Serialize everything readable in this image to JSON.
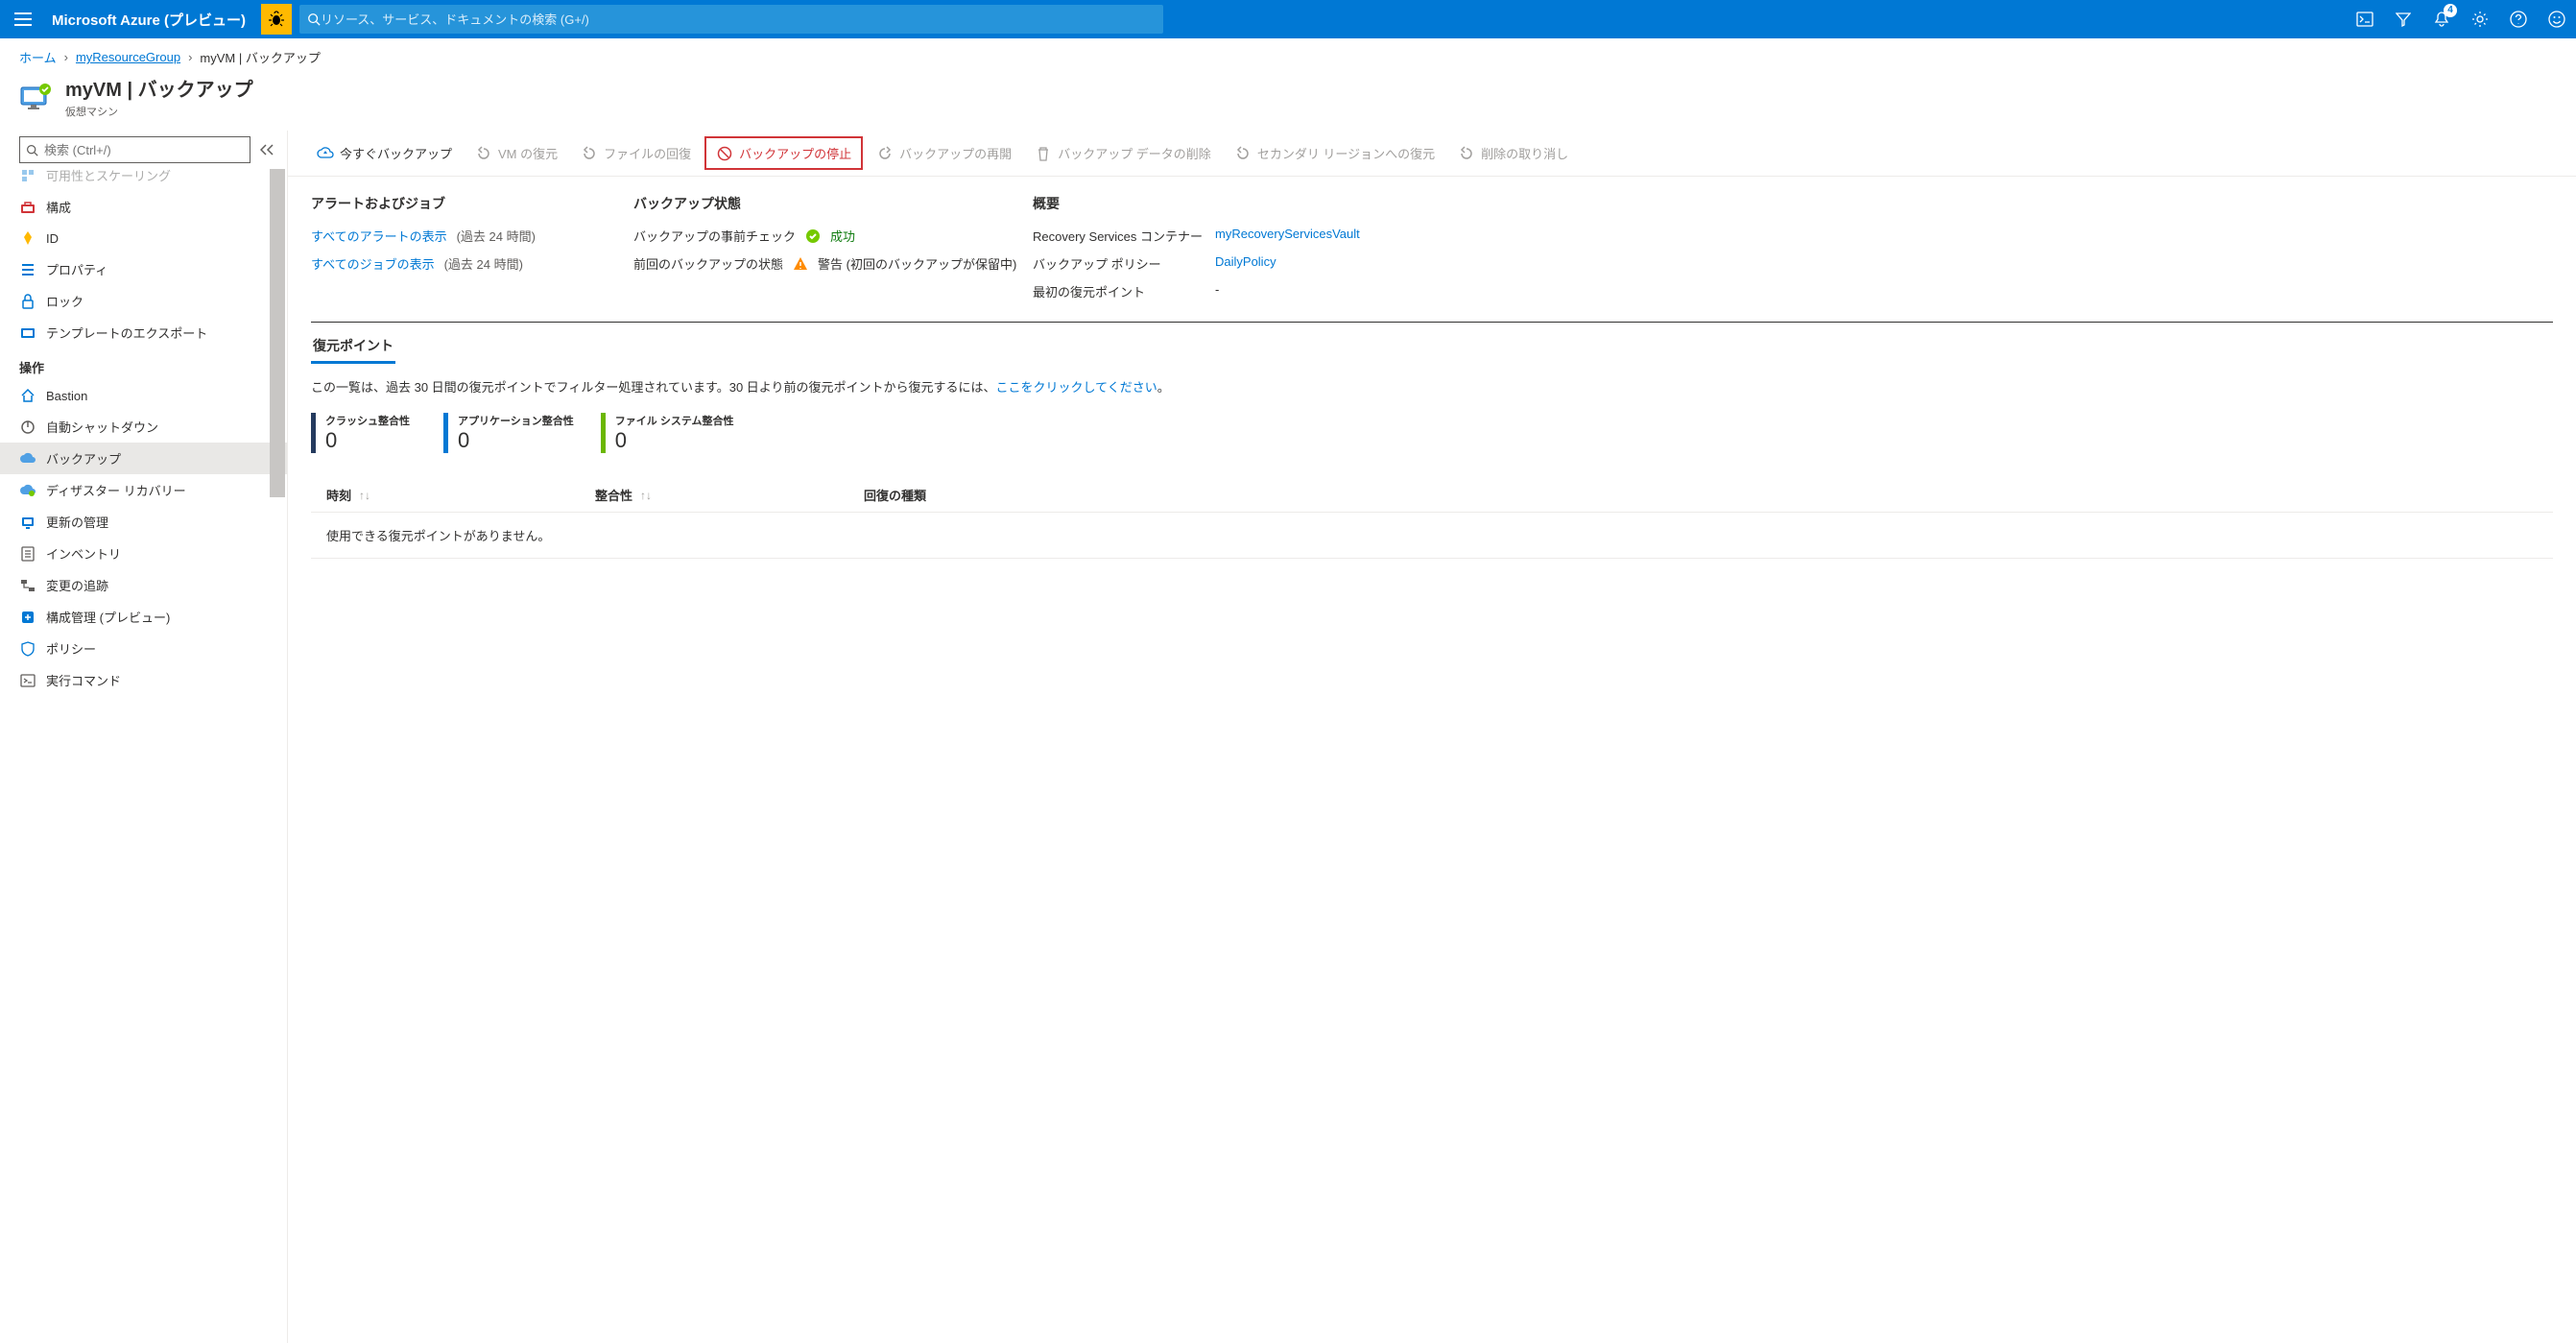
{
  "topbar": {
    "brand": "Microsoft Azure (プレビュー)",
    "search_placeholder": "リソース、サービス、ドキュメントの検索 (G+/)",
    "notification_count": "4"
  },
  "breadcrumb": {
    "home": "ホーム",
    "rg": "myResourceGroup",
    "current": "myVM | バックアップ"
  },
  "resource": {
    "title": "myVM | バックアップ",
    "subtitle": "仮想マシン"
  },
  "sidebar": {
    "search_placeholder": "検索 (Ctrl+/)",
    "items_top": [
      {
        "label": "可用性とスケーリング",
        "icon": "scale"
      },
      {
        "label": "構成",
        "icon": "config"
      },
      {
        "label": "ID",
        "icon": "id"
      },
      {
        "label": "プロパティ",
        "icon": "props"
      },
      {
        "label": "ロック",
        "icon": "lock"
      },
      {
        "label": "テンプレートのエクスポート",
        "icon": "export"
      }
    ],
    "group_ops": "操作",
    "items_ops": [
      {
        "label": "Bastion",
        "icon": "bastion"
      },
      {
        "label": "自動シャットダウン",
        "icon": "autoshut"
      },
      {
        "label": "バックアップ",
        "icon": "backup",
        "active": true
      },
      {
        "label": "ディザスター リカバリー",
        "icon": "dr"
      },
      {
        "label": "更新の管理",
        "icon": "update"
      },
      {
        "label": "インベントリ",
        "icon": "inventory"
      },
      {
        "label": "変更の追跡",
        "icon": "change"
      },
      {
        "label": "構成管理 (プレビュー)",
        "icon": "configmgmt"
      },
      {
        "label": "ポリシー",
        "icon": "policy"
      },
      {
        "label": "実行コマンド",
        "icon": "runcmd"
      }
    ]
  },
  "toolbar": {
    "backup_now": "今すぐバックアップ",
    "restore_vm": "VM の復元",
    "file_recovery": "ファイルの回復",
    "stop_backup": "バックアップの停止",
    "resume_backup": "バックアップの再開",
    "delete_data": "バックアップ データの削除",
    "secondary_restore": "セカンダリ リージョンへの復元",
    "undo_delete": "削除の取り消し"
  },
  "alerts": {
    "heading": "アラートおよびジョブ",
    "view_alerts": "すべてのアラートの表示",
    "alerts_window": "(過去 24 時間)",
    "view_jobs": "すべてのジョブの表示",
    "jobs_window": "(過去 24 時間)"
  },
  "status": {
    "heading": "バックアップ状態",
    "precheck_label": "バックアップの事前チェック",
    "precheck_value": "成功",
    "last_label": "前回のバックアップの状態",
    "last_value": "警告 (初回のバックアップが保留中)"
  },
  "summary": {
    "heading": "概要",
    "vault_label": "Recovery Services コンテナー",
    "vault_value": "myRecoveryServicesVault",
    "policy_label": "バックアップ ポリシー",
    "policy_value": "DailyPolicy",
    "first_rp_label": "最初の復元ポイント",
    "first_rp_value": "-"
  },
  "tabs": {
    "restore_points": "復元ポイント"
  },
  "desc": {
    "text_before": "この一覧は、過去 30 日間の復元ポイントでフィルター処理されています。30 日より前の復元ポイントから復元するには、",
    "link": "ここをクリックしてください",
    "text_after": "。"
  },
  "counters": {
    "crash_label": "クラッシュ整合性",
    "crash_value": "0",
    "app_label": "アプリケーション整合性",
    "app_value": "0",
    "fs_label": "ファイル システム整合性",
    "fs_value": "0"
  },
  "table": {
    "col_time": "時刻",
    "col_consistency": "整合性",
    "col_recovery": "回復の種類",
    "empty": "使用できる復元ポイントがありません。"
  }
}
